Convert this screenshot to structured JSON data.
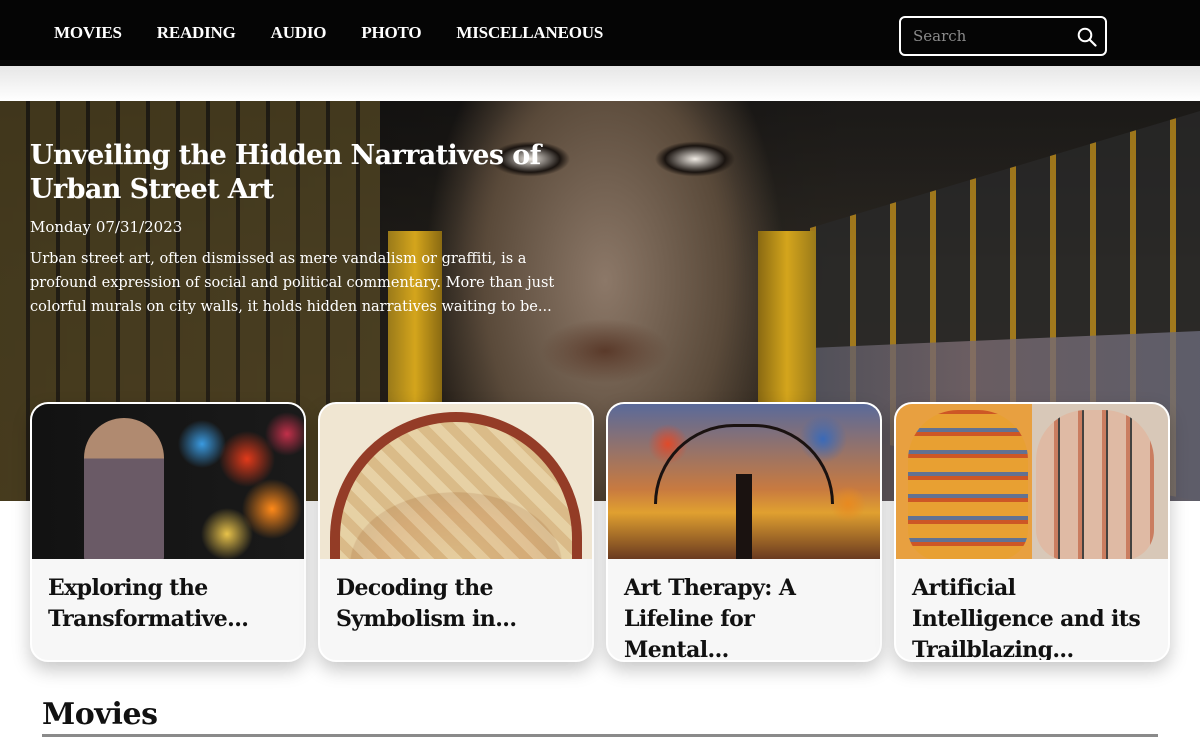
{
  "nav": {
    "items": [
      {
        "label": "MOVIES"
      },
      {
        "label": "READING"
      },
      {
        "label": "AUDIO"
      },
      {
        "label": "PHOTO"
      },
      {
        "label": "MISCELLANEOUS"
      }
    ],
    "search": {
      "placeholder": "Search",
      "icon": "search-icon"
    }
  },
  "hero": {
    "title": "Unveiling the Hidden Narratives of Urban Street Art",
    "date": "Monday 07/31/2023",
    "excerpt": "Urban street art, often dismissed as mere vandalism or graffiti, is a profound expression of social and political commentary. More than just colorful murals on city walls, it holds hidden narratives waiting to be..."
  },
  "cards": [
    {
      "title": "Exploring the Transformative..."
    },
    {
      "title": "Decoding the Symbolism in..."
    },
    {
      "title": "Art Therapy: A Lifeline for Mental..."
    },
    {
      "title": "Artificial Intelligence and its Trailblazing..."
    }
  ],
  "section": {
    "heading": "Movies"
  },
  "colors": {
    "nav_bg": "#050505",
    "nav_text": "#ffffff",
    "card_bg": "#f7f7f7",
    "rule": "#8a8a8a"
  }
}
